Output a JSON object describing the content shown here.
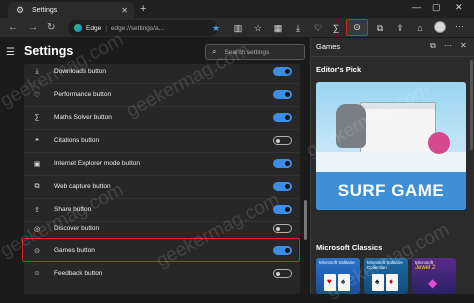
{
  "tab": {
    "title": "Settings"
  },
  "address_bar": {
    "label": "Edge",
    "url": "edge://settings/a..."
  },
  "settings": {
    "title": "Settings",
    "search_placeholder": "Search settings",
    "items": [
      {
        "label": "Downloads button",
        "icon": "download-icon",
        "enabled": true
      },
      {
        "label": "Performance button",
        "icon": "heart-pulse-icon",
        "enabled": true
      },
      {
        "label": "Maths Solver button",
        "icon": "math-icon",
        "enabled": true
      },
      {
        "label": "Citations button",
        "icon": "quote-icon",
        "enabled": false
      },
      {
        "label": "Internet Explorer mode button",
        "icon": "ie-icon",
        "enabled": true
      },
      {
        "label": "Web capture button",
        "icon": "capture-icon",
        "enabled": true
      },
      {
        "label": "Share button",
        "icon": "share-icon",
        "enabled": true
      },
      {
        "label": "Discover button",
        "icon": "discover-icon",
        "enabled": false
      },
      {
        "label": "Games button",
        "icon": "gamepad-icon",
        "enabled": true
      },
      {
        "label": "Feedback button",
        "icon": "feedback-icon",
        "enabled": false
      }
    ]
  },
  "games_panel": {
    "title": "Games",
    "editors_pick": "Editor's Pick",
    "featured_game": "SURF GAME",
    "section": "Microsoft Classics",
    "tiles": [
      {
        "caption": "Microsoft Solitaire",
        "subcaption": ""
      },
      {
        "caption": "Microsoft Solitaire Collection",
        "subcaption": ""
      },
      {
        "caption": "Microsoft",
        "subcaption": "Jewel 2"
      }
    ]
  },
  "watermark": "geekermag.com",
  "colors": {
    "accent": "#3b8ee8",
    "highlight": "#e02020",
    "background": "#1b1b1b",
    "panel": "#2b2b2b"
  }
}
